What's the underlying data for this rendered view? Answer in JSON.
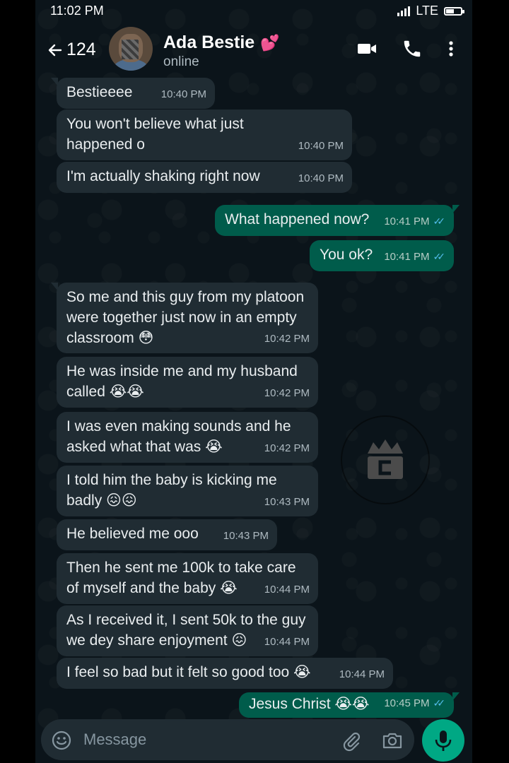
{
  "status_bar": {
    "time": "11:02 PM",
    "network": "LTE"
  },
  "header": {
    "back_count": "124",
    "contact_name": "Ada Bestie",
    "contact_emoji": "💕",
    "presence": "online",
    "icons": [
      "video-call-icon",
      "voice-call-icon",
      "more-options-icon"
    ]
  },
  "messages": [
    {
      "dir": "in",
      "text": "Bestieeee",
      "time": "10:40 PM"
    },
    {
      "dir": "in",
      "text": "You won't believe what just\nhappened o",
      "time": "10:40 PM"
    },
    {
      "dir": "in",
      "text": "I'm actually shaking right now",
      "time": "10:40 PM"
    },
    {
      "dir": "out",
      "text": "What happened now?",
      "time": "10:41 PM"
    },
    {
      "dir": "out",
      "text": "You ok?",
      "time": "10:41 PM"
    },
    {
      "dir": "in",
      "text": "So me and this guy from my platoon\nwere together just now in an empty\nclassroom 😳",
      "time": "10:42 PM"
    },
    {
      "dir": "in",
      "text": "He was inside me and my husband\ncalled 😭😭",
      "time": "10:42 PM"
    },
    {
      "dir": "in",
      "text": "I was even making sounds and he\nasked what that was 😭",
      "time": "10:42 PM"
    },
    {
      "dir": "in",
      "text": "I told him the baby is kicking me\nbadly 😖😖",
      "time": "10:43 PM"
    },
    {
      "dir": "in",
      "text": "He believed me ooo",
      "time": "10:43 PM"
    },
    {
      "dir": "in",
      "text": "Then he sent me 100k to take care\nof myself and the baby 😭",
      "time": "10:44 PM"
    },
    {
      "dir": "in",
      "text": "As I received it, I sent 50k to the guy\nwe dey share enjoyment 😖",
      "time": "10:44 PM"
    },
    {
      "dir": "in",
      "text": "I feel so bad but it felt so good too 😭",
      "time": "10:44 PM"
    },
    {
      "dir": "out",
      "text": "Jesus Christ 😭😭",
      "time": "10:45 PM"
    }
  ],
  "input": {
    "placeholder": "Message"
  },
  "colors": {
    "background": "#0b141a",
    "incoming": "#202c33",
    "outgoing": "#005c4b",
    "accent": "#00a884",
    "read_tick": "#53bdeb"
  }
}
